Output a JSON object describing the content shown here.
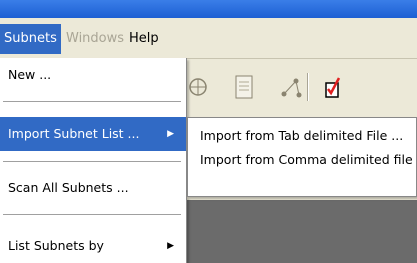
{
  "menubar": {
    "items": [
      {
        "label": "Subnets",
        "state": "open"
      },
      {
        "label": "Windows",
        "state": "disabled"
      },
      {
        "label": "Help",
        "state": "normal"
      }
    ]
  },
  "subnets_menu": {
    "items": [
      {
        "label": "New ..."
      },
      {
        "label": "Import Subnet List ...",
        "has_submenu": true,
        "highlighted": true
      },
      {
        "label": "Scan All Subnets ..."
      },
      {
        "label": "List Subnets by",
        "has_submenu": true
      }
    ]
  },
  "import_submenu": {
    "items": [
      {
        "label": "Import from Tab delimited File ..."
      },
      {
        "label": "Import from Comma delimited file ..."
      }
    ]
  },
  "toolbar": {
    "icons": [
      "network-icon",
      "document-icon",
      "graph-icon",
      "checklist-icon"
    ]
  },
  "colors": {
    "highlight": "#316ac5",
    "menu_bg": "#ece9d8",
    "titlebar": "#1d5fd3",
    "disabled_text": "#a9a595"
  }
}
